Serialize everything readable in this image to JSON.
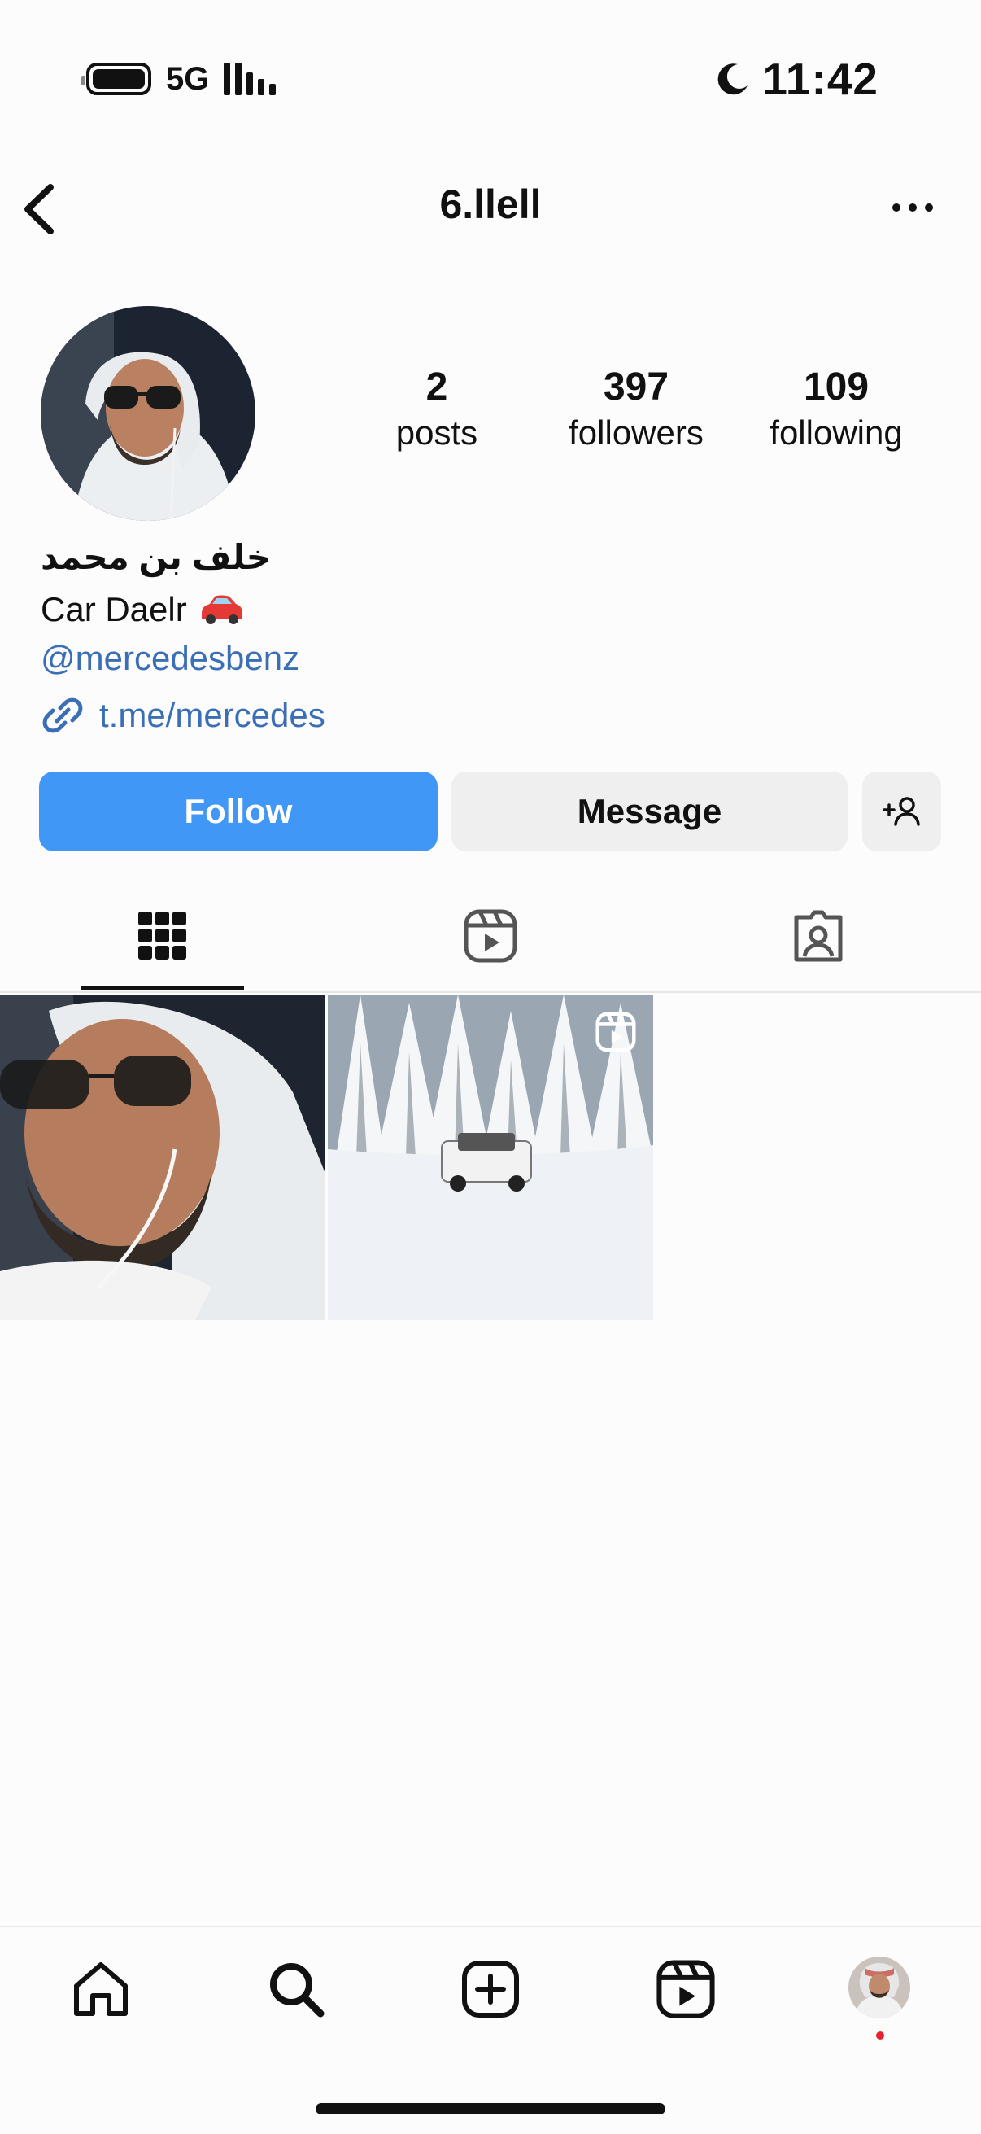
{
  "status_bar": {
    "network": "5G",
    "time": "11:42"
  },
  "header": {
    "username": "6.llell"
  },
  "profile": {
    "stats": [
      {
        "value": "2",
        "label": "posts"
      },
      {
        "value": "397",
        "label": "followers"
      },
      {
        "value": "109",
        "label": "following"
      }
    ],
    "full_name": "خلف بن محمد",
    "bio": "Car Daelr",
    "bio_emoji": "🚗",
    "mention": "@mercedesbenz",
    "link": "t.me/mercedes"
  },
  "actions": {
    "follow_label": "Follow",
    "message_label": "Message"
  },
  "tabs": [
    {
      "name": "grid",
      "icon": "grid-icon",
      "active": true
    },
    {
      "name": "reels",
      "icon": "reels-icon",
      "active": false
    },
    {
      "name": "tagged",
      "icon": "tagged-icon",
      "active": false
    }
  ],
  "posts": [
    {
      "type": "photo",
      "subject": "portrait"
    },
    {
      "type": "reel",
      "subject": "snow-car"
    }
  ],
  "bottom_nav": [
    {
      "name": "home",
      "icon": "home-icon"
    },
    {
      "name": "search",
      "icon": "search-icon"
    },
    {
      "name": "create",
      "icon": "plus-square-icon"
    },
    {
      "name": "reels",
      "icon": "reels-icon"
    },
    {
      "name": "profile",
      "icon": "avatar"
    }
  ],
  "colors": {
    "accent": "#4197f5",
    "link": "#3b6fb5",
    "notification_dot": "#e8232b"
  }
}
